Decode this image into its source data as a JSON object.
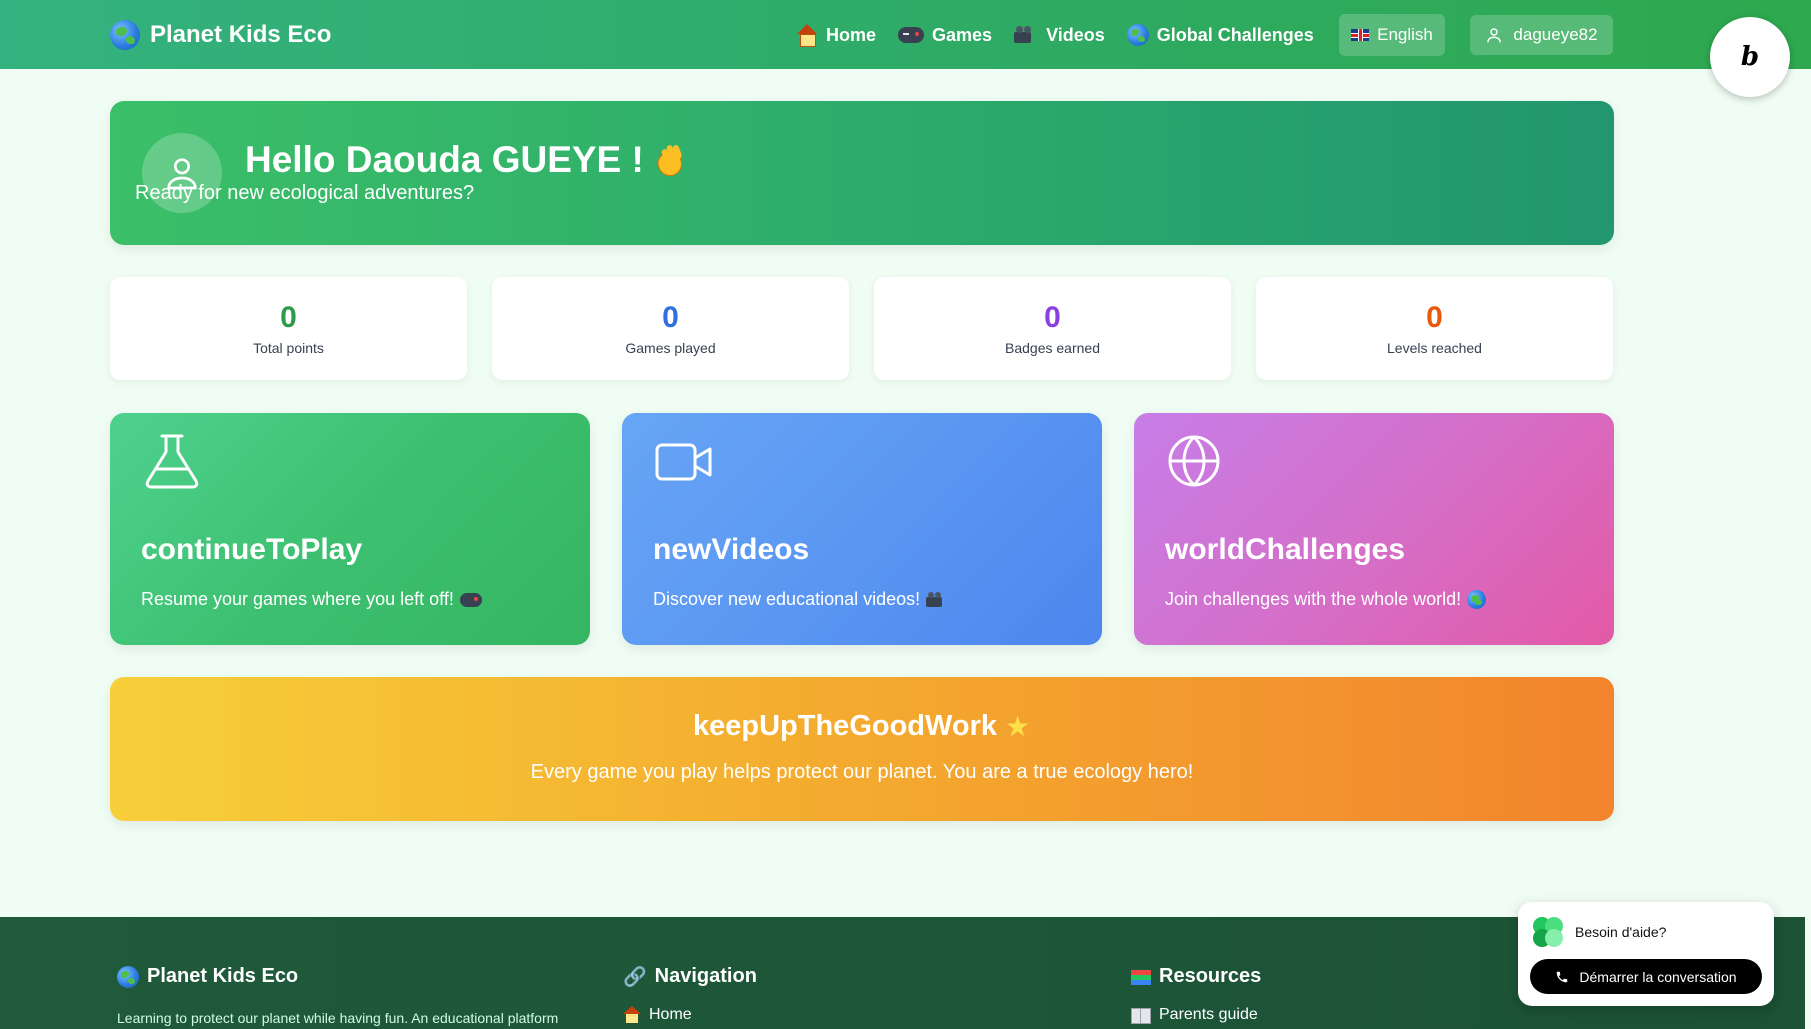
{
  "header": {
    "brand": "Planet Kids Eco",
    "nav": [
      {
        "label": "Home",
        "icon": "house-icon"
      },
      {
        "label": "Games",
        "icon": "gamepad-icon"
      },
      {
        "label": "Videos",
        "icon": "camera-icon"
      },
      {
        "label": "Global Challenges",
        "icon": "globe-icon"
      }
    ],
    "language": "English",
    "username": "dagueye82",
    "badge_letter": "b"
  },
  "hero": {
    "title": "Hello Daouda GUEYE !",
    "subtitle": "Ready for new ecological adventures?"
  },
  "stats": [
    {
      "value": "0",
      "label": "Total points",
      "color": "#2e9b4b"
    },
    {
      "value": "0",
      "label": "Games played",
      "color": "#2f6fe0"
    },
    {
      "value": "0",
      "label": "Badges earned",
      "color": "#8a3fe0"
    },
    {
      "value": "0",
      "label": "Levels reached",
      "color": "#ea580c"
    }
  ],
  "cards": [
    {
      "title": "continueToPlay",
      "desc": "Resume your games where you left off!",
      "icon": "flask-icon"
    },
    {
      "title": "newVideos",
      "desc": "Discover new educational videos!",
      "icon": "video-icon"
    },
    {
      "title": "worldChallenges",
      "desc": "Join challenges with the whole world!",
      "icon": "globe-outline-icon"
    }
  ],
  "banner": {
    "title": "keepUpTheGoodWork",
    "subtitle": "Every game you play helps protect our planet. You are a true ecology hero!"
  },
  "footer": {
    "brand": "Planet Kids Eco",
    "about": "Learning to protect our planet while having fun. An educational platform",
    "nav_title": "Navigation",
    "nav_first": "Home",
    "resources_title": "Resources",
    "resources_first": "Parents guide"
  },
  "help": {
    "question": "Besoin d'aide?",
    "button": "Démarrer la conversation"
  },
  "colors": {
    "header_green": "#2eaa62",
    "accent_green": "#3bbf68",
    "blue_card": "#5b97f2",
    "purple_card": "#c77ce8",
    "banner_orange": "#f2842d",
    "footer_green": "#1f5a3a"
  }
}
